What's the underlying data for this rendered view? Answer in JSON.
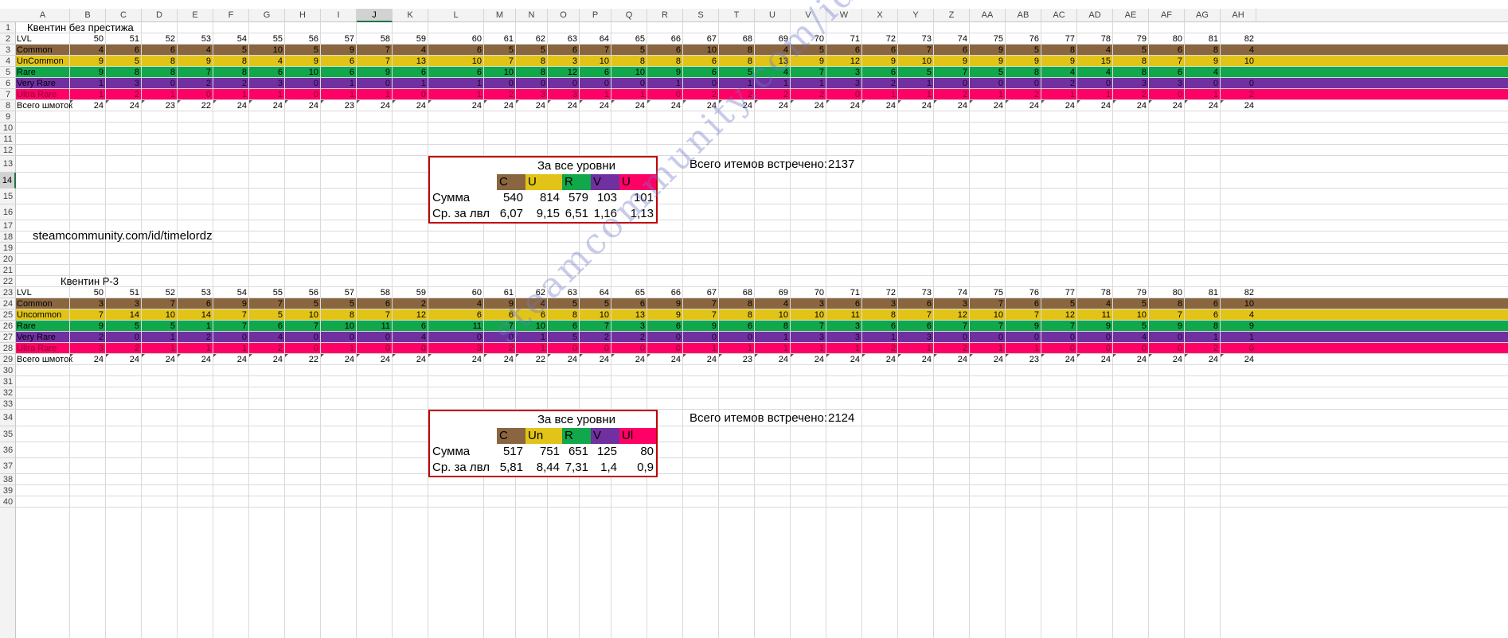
{
  "columns": [
    "A",
    "B",
    "C",
    "D",
    "E",
    "F",
    "G",
    "H",
    "I",
    "J",
    "K",
    "L",
    "M",
    "N",
    "O",
    "P",
    "Q",
    "R",
    "S",
    "T",
    "U",
    "V",
    "W",
    "X",
    "Y",
    "Z",
    "AA",
    "AB",
    "AC",
    "AD",
    "AE",
    "AF",
    "AG",
    "AH"
  ],
  "selected_column": "J",
  "row_numbers": [
    "1",
    "2",
    "3",
    "4",
    "5",
    "6",
    "7",
    "8",
    "9",
    "10",
    "11",
    "12",
    "13",
    "14",
    "15",
    "16",
    "17",
    "18",
    "19",
    "20",
    "21",
    "22",
    "23",
    "24",
    "25",
    "26",
    "27",
    "28",
    "29",
    "30",
    "31",
    "32",
    "33",
    "34",
    "35",
    "36",
    "37",
    "38",
    "39",
    "40"
  ],
  "selected_row": "14",
  "colors": {
    "common": "#8a6640",
    "uncommon": "#e2c418",
    "rare": "#10a84a",
    "very_rare": "#7030a0",
    "ultra_rare": "#ff0066",
    "table_border": "#c00000",
    "watermark": "#8c95d2"
  },
  "block1": {
    "title": "Квентин без престижа",
    "lvl_label": "LVL",
    "levels": [
      "50",
      "51",
      "52",
      "53",
      "54",
      "55",
      "56",
      "57",
      "58",
      "59",
      "60",
      "61",
      "62",
      "63",
      "64",
      "65",
      "66",
      "67",
      "68",
      "69",
      "70",
      "71",
      "72",
      "73",
      "74",
      "75",
      "76",
      "77",
      "78",
      "79",
      "80",
      "81",
      "82"
    ],
    "rows": [
      {
        "key": "common",
        "label": "Common",
        "values": [
          "4",
          "6",
          "6",
          "4",
          "5",
          "10",
          "5",
          "9",
          "7",
          "4",
          "6",
          "5",
          "5",
          "6",
          "7",
          "5",
          "6",
          "10",
          "8",
          "4",
          "5",
          "6",
          "6",
          "7",
          "6",
          "9",
          "5",
          "8",
          "4",
          "5",
          "6",
          "8",
          "4"
        ]
      },
      {
        "key": "uncommon",
        "label": "UnCommon",
        "values": [
          "9",
          "5",
          "8",
          "9",
          "8",
          "4",
          "9",
          "6",
          "7",
          "13",
          "10",
          "7",
          "8",
          "3",
          "10",
          "8",
          "8",
          "6",
          "8",
          "13",
          "9",
          "12",
          "9",
          "10",
          "9",
          "9",
          "9",
          "9",
          "15",
          "8",
          "7",
          "9",
          "10"
        ]
      },
      {
        "key": "rare",
        "label": "Rare",
        "values": [
          "9",
          "8",
          "8",
          "7",
          "8",
          "6",
          "10",
          "6",
          "9",
          "6",
          "6",
          "10",
          "8",
          "12",
          "6",
          "10",
          "9",
          "6",
          "5",
          "4",
          "7",
          "3",
          "6",
          "5",
          "7",
          "5",
          "8",
          "4",
          "4",
          "8",
          "6",
          "4"
        ]
      },
      {
        "key": "very_rare",
        "label": "Very Rare",
        "values": [
          "1",
          "3",
          "0",
          "2",
          "2",
          "3",
          "0",
          "1",
          "0",
          "1",
          "1",
          "0",
          "0",
          "0",
          "0",
          "0",
          "1",
          "0",
          "1",
          "1",
          "1",
          "3",
          "2",
          "1",
          "0",
          "0",
          "0",
          "2",
          "0",
          "3",
          "3",
          "0",
          "0"
        ]
      },
      {
        "key": "ultra_rare",
        "label": "Ultra Rare",
        "values": [
          "1",
          "2",
          "1",
          "0",
          "1",
          "1",
          "0",
          "1",
          "1",
          "0",
          "1",
          "2",
          "3",
          "3",
          "1",
          "1",
          "0",
          "2",
          "2",
          "2",
          "2",
          "0",
          "1",
          "1",
          "2",
          "1",
          "2",
          "1",
          "1",
          "2",
          "0",
          "1",
          "2"
        ]
      }
    ],
    "total_label": "Всего шмоток",
    "totals": [
      "24",
      "24",
      "23",
      "22",
      "24",
      "24",
      "24",
      "23",
      "24",
      "24",
      "24",
      "24",
      "24",
      "24",
      "24",
      "24",
      "24",
      "24",
      "24",
      "24",
      "24",
      "24",
      "24",
      "24",
      "24",
      "24",
      "24",
      "24",
      "24",
      "24",
      "24",
      "24",
      "24"
    ],
    "summary": {
      "caption": "За все уровни",
      "headers": [
        "C",
        "U",
        "R",
        "V",
        "U"
      ],
      "sum_label": "Сумма",
      "sums": [
        "540",
        "814",
        "579",
        "103",
        "101"
      ],
      "avg_label": "Ср. за лвл",
      "avgs": [
        "6,07",
        "9,15",
        "6,51",
        "1,16",
        "1,13"
      ]
    },
    "total_items_label": "Всего итемов встречено:",
    "total_items": "2137"
  },
  "link_text": "steamcommunity.com/id/timelordz",
  "block2": {
    "title": "Квентин Р-3",
    "lvl_label": "LVL",
    "levels": [
      "50",
      "51",
      "52",
      "53",
      "54",
      "55",
      "56",
      "57",
      "58",
      "59",
      "60",
      "61",
      "62",
      "63",
      "64",
      "65",
      "66",
      "67",
      "68",
      "69",
      "70",
      "71",
      "72",
      "73",
      "74",
      "75",
      "76",
      "77",
      "78",
      "79",
      "80",
      "81",
      "82"
    ],
    "rows": [
      {
        "key": "common",
        "label": "Common",
        "values": [
          "3",
          "3",
          "7",
          "6",
          "9",
          "7",
          "5",
          "5",
          "6",
          "2",
          "4",
          "9",
          "4",
          "5",
          "5",
          "6",
          "9",
          "7",
          "8",
          "4",
          "3",
          "6",
          "3",
          "6",
          "3",
          "7",
          "6",
          "5",
          "4",
          "5",
          "8",
          "6",
          "10"
        ]
      },
      {
        "key": "uncommon",
        "label": "Uncommon",
        "values": [
          "7",
          "14",
          "10",
          "14",
          "7",
          "5",
          "10",
          "8",
          "7",
          "12",
          "6",
          "6",
          "6",
          "8",
          "10",
          "13",
          "9",
          "7",
          "8",
          "10",
          "10",
          "11",
          "8",
          "7",
          "12",
          "10",
          "7",
          "12",
          "11",
          "10",
          "7",
          "6",
          "4"
        ]
      },
      {
        "key": "rare",
        "label": "Rare",
        "values": [
          "9",
          "5",
          "5",
          "1",
          "7",
          "6",
          "7",
          "10",
          "11",
          "6",
          "11",
          "7",
          "10",
          "6",
          "7",
          "3",
          "6",
          "9",
          "6",
          "8",
          "7",
          "3",
          "6",
          "6",
          "7",
          "7",
          "9",
          "7",
          "9",
          "5",
          "9",
          "8",
          "9"
        ]
      },
      {
        "key": "very_rare",
        "label": "Very Rare",
        "values": [
          "2",
          "0",
          "1",
          "2",
          "0",
          "4",
          "0",
          "0",
          "0",
          "4",
          "0",
          "0",
          "1",
          "5",
          "2",
          "2",
          "0",
          "0",
          "0",
          "1",
          "3",
          "3",
          "1",
          "3",
          "0",
          "0",
          "0",
          "0",
          "0",
          "4",
          "0",
          "1",
          "1"
        ]
      },
      {
        "key": "ultra_rare",
        "label": "Ultra Rare",
        "values": [
          "3",
          "2",
          "1",
          "1",
          "1",
          "2",
          "0",
          "1",
          "0",
          "0",
          "3",
          "2",
          "1",
          "0",
          "0",
          "0",
          "0",
          "1",
          "1",
          "1",
          "1",
          "1",
          "2",
          "1",
          "2",
          "1",
          "1",
          "0",
          "0",
          "0",
          "0",
          "2",
          "0"
        ]
      }
    ],
    "total_label": "Всего шмоток",
    "totals": [
      "24",
      "24",
      "24",
      "24",
      "24",
      "24",
      "22",
      "24",
      "24",
      "24",
      "24",
      "24",
      "22",
      "24",
      "24",
      "24",
      "24",
      "24",
      "23",
      "24",
      "24",
      "24",
      "24",
      "24",
      "24",
      "24",
      "23",
      "24",
      "24",
      "24",
      "24",
      "24",
      "24"
    ],
    "summary": {
      "caption": "За все уровни",
      "headers": [
        "C",
        "Un",
        "R",
        "V",
        "Ul"
      ],
      "sum_label": "Сумма",
      "sums": [
        "517",
        "751",
        "651",
        "125",
        "80"
      ],
      "avg_label": "Ср. за лвл",
      "avgs": [
        "5,81",
        "8,44",
        "7,31",
        "1,4",
        "0,9"
      ]
    },
    "total_items_label": "Всего итемов встречено:",
    "total_items": "2124"
  },
  "watermark_text": "steamcommunity.com/id/timelordz"
}
